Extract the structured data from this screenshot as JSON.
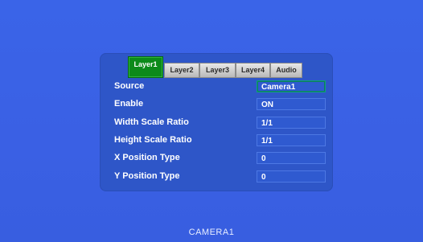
{
  "osd": {
    "tabs": [
      {
        "label": "Layer1",
        "active": true
      },
      {
        "label": "Layer2",
        "active": false
      },
      {
        "label": "Layer3",
        "active": false
      },
      {
        "label": "Layer4",
        "active": false
      },
      {
        "label": "Audio",
        "active": false
      }
    ],
    "rows": [
      {
        "label": "Source",
        "value": "Camera1",
        "selected": true
      },
      {
        "label": "Enable",
        "value": "ON",
        "selected": false
      },
      {
        "label": "Width Scale Ratio",
        "value": "1/1",
        "selected": false
      },
      {
        "label": "Height Scale Ratio",
        "value": "1/1",
        "selected": false
      },
      {
        "label": "X Position Type",
        "value": "0",
        "selected": false
      },
      {
        "label": "Y Position Type",
        "value": "0",
        "selected": false
      }
    ]
  },
  "channel_label": "CAMERA1",
  "colors": {
    "background": "#3a62e6",
    "panel": "#2e56c8",
    "active_tab": "#0c8a1a",
    "inactive_tab": "#c8c8c8",
    "selected_value_border": "#0fa07a"
  }
}
